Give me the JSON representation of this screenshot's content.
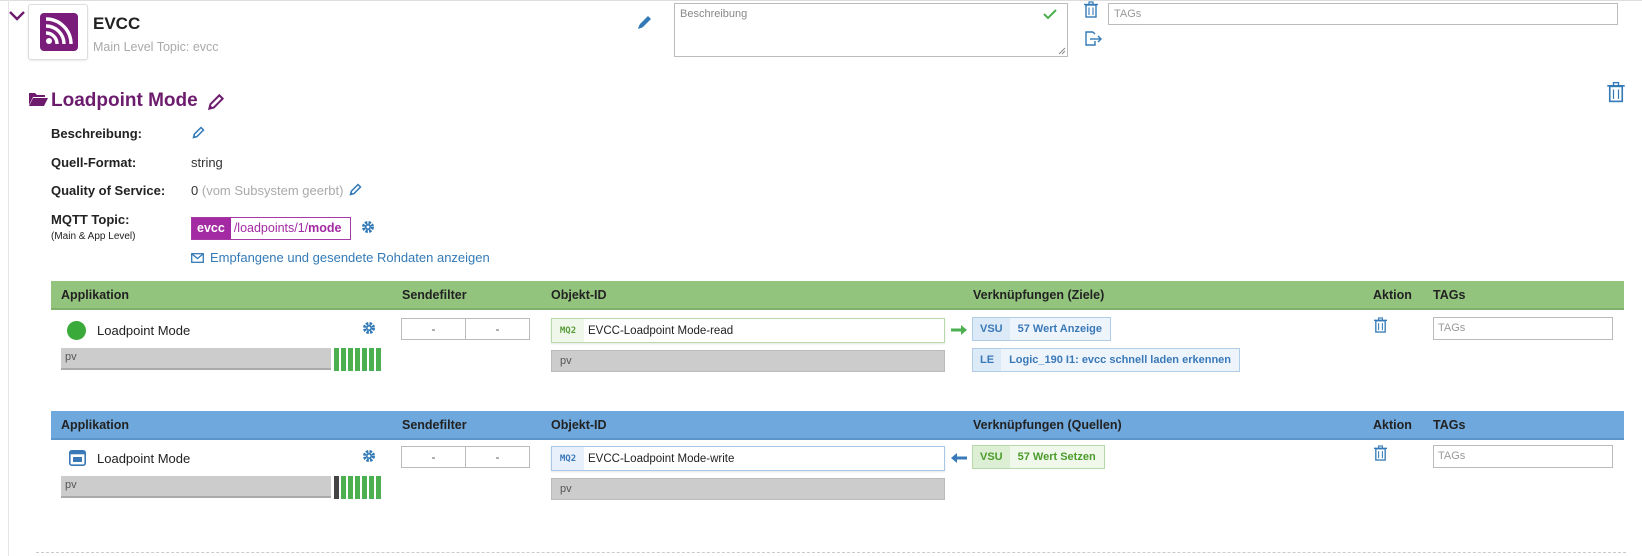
{
  "header": {
    "app_name": "EVCC",
    "main_topic": "Main Level Topic: evcc",
    "description_placeholder": "Beschreibung",
    "tags_placeholder": "TAGs"
  },
  "datapoint": {
    "title": "Loadpoint Mode",
    "fields": {
      "description_label": "Beschreibung:",
      "source_format_label": "Quell-Format:",
      "source_format_value": "string",
      "qos_label": "Quality of Service:",
      "qos_value": "0",
      "qos_note": "(vom Subsystem geerbt)",
      "mqtt_label": "MQTT Topic:",
      "mqtt_sublabel": "(Main & App Level)",
      "mqtt_prefix": "evcc",
      "mqtt_path": "/loadpoints/1/",
      "mqtt_leaf": "mode"
    },
    "raw_data_link": "Empfangene und gesendete Rohdaten anzeigen"
  },
  "table_read": {
    "columns": {
      "app": "Applikation",
      "filter": "Sendefilter",
      "object": "Objekt-ID",
      "links": "Verknüpfungen (Ziele)",
      "action": "Aktion",
      "tags": "TAGs"
    },
    "row": {
      "app_label": "Loadpoint Mode",
      "pv": "pv",
      "filter_a": "-",
      "filter_b": "-",
      "obj_tag": "MQ2",
      "obj_id": "EVCC-Loadpoint Mode-read",
      "obj_pv": "pv",
      "links": [
        {
          "code": "VSU",
          "name": "57 Wert Anzeige"
        },
        {
          "code": "LE",
          "name": "Logic_190 I1: evcc schnell laden erkennen"
        }
      ],
      "tags_placeholder": "TAGs"
    }
  },
  "table_write": {
    "columns": {
      "app": "Applikation",
      "filter": "Sendefilter",
      "object": "Objekt-ID",
      "links": "Verknüpfungen (Quellen)",
      "action": "Aktion",
      "tags": "TAGs"
    },
    "row": {
      "app_label": "Loadpoint Mode",
      "pv": "pv",
      "filter_a": "-",
      "filter_b": "-",
      "obj_tag": "MQ2",
      "obj_id": "EVCC-Loadpoint Mode-write",
      "obj_pv": "pv",
      "links": [
        {
          "code": "VSU",
          "name": "57 Wert Setzen"
        }
      ],
      "tags_placeholder": "TAGs"
    }
  },
  "colors": {
    "title_purple": "#6d1c6d",
    "mqtt_purple": "#a32aa3",
    "header_green": "#93c47d",
    "header_blue": "#6fa8dc",
    "link_blue": "#337ab7"
  }
}
